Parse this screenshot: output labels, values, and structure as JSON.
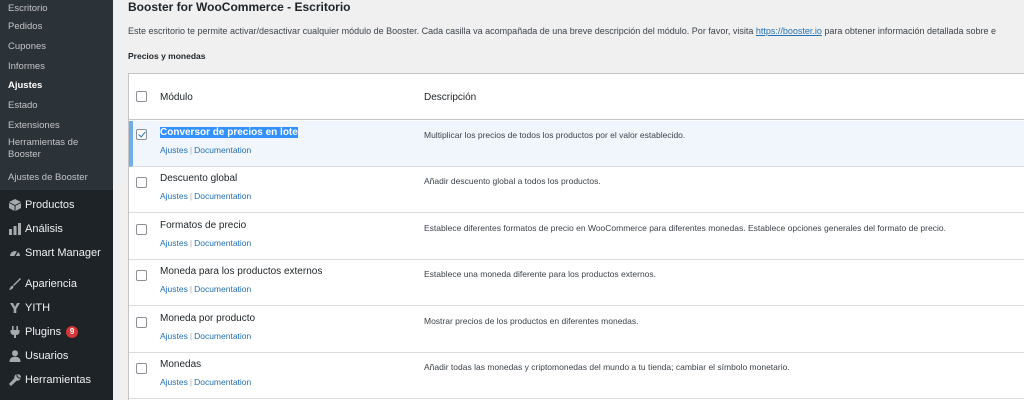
{
  "sidebar": {
    "submenu": [
      {
        "label": "Escritorio",
        "current": false
      },
      {
        "label": "Pedidos",
        "current": false
      },
      {
        "label": "Cupones",
        "current": false
      },
      {
        "label": "Informes",
        "current": false
      },
      {
        "label": "Ajustes",
        "current": true
      },
      {
        "label": "Estado",
        "current": false
      },
      {
        "label": "Extensiones",
        "current": false
      },
      {
        "label": "Herramientas de Booster",
        "current": false
      },
      {
        "label": "Ajustes de Booster",
        "current": false
      }
    ],
    "menu": [
      {
        "label": "Productos",
        "icon": "box-icon"
      },
      {
        "label": "Análisis",
        "icon": "bar-chart-icon"
      },
      {
        "label": "Smart Manager",
        "icon": "dashboard-icon"
      },
      {
        "label": "Apariencia",
        "icon": "paintbrush-icon"
      },
      {
        "label": "YITH",
        "icon": "yith-icon"
      },
      {
        "label": "Plugins",
        "icon": "plugin-icon",
        "badge": "9"
      },
      {
        "label": "Usuarios",
        "icon": "user-icon"
      },
      {
        "label": "Herramientas",
        "icon": "wrench-icon"
      }
    ]
  },
  "page": {
    "title": "Booster for WooCommerce - Escritorio",
    "intro_text": "Este escritorio te permite activar/desactivar cualquier módulo de Booster. Cada casilla va acompañada de una breve descripción del módulo. Por favor, visita ",
    "intro_link": "https://booster.io",
    "intro_after": " para obtener información detallada sobre e",
    "section_title": "Precios y monedas"
  },
  "table": {
    "col_module": "Módulo",
    "col_description": "Descripción",
    "action_settings": "Ajustes",
    "action_separator": "|",
    "action_docs": "Documentation",
    "rows": [
      {
        "name": "Conversor de precios en lote",
        "description": "Multiplicar los precios de todos los productos por el valor establecido.",
        "checked": true
      },
      {
        "name": "Descuento global",
        "description": "Añadir descuento global a todos los productos.",
        "checked": false
      },
      {
        "name": "Formatos de precio",
        "description": "Establece diferentes formatos de precio en WooCommerce para diferentes monedas. Establece opciones generales del formato de precio.",
        "checked": false
      },
      {
        "name": "Moneda para los productos externos",
        "description": "Establece una moneda diferente para los productos externos.",
        "checked": false
      },
      {
        "name": "Moneda por producto",
        "description": "Mostrar precios de los productos en diferentes monedas.",
        "checked": false
      },
      {
        "name": "Monedas",
        "description": "Añadir todas las monedas y criptomonedas del mundo a tu tienda; cambiar el símbolo monetario.",
        "checked": false
      }
    ]
  },
  "colors": {
    "sidebar_bg": "#1d2327",
    "submenu_bg": "#2c3338",
    "link": "#2271b1",
    "active_row_bg": "#f0f6fc",
    "active_border": "#72aee6",
    "badge": "#d63638"
  }
}
